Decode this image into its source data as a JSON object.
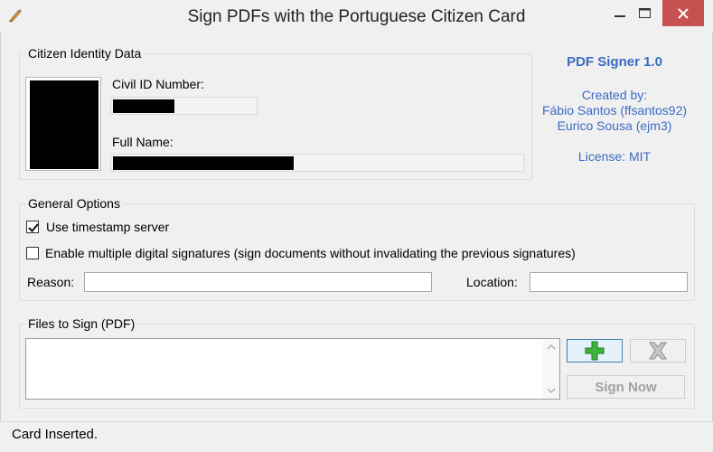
{
  "window": {
    "title": "Sign PDFs with the Portuguese Citizen Card"
  },
  "identity": {
    "group_title": "Citizen Identity Data",
    "civil_id_label": "Civil ID Number:",
    "full_name_label": "Full Name:"
  },
  "about": {
    "app_name": "PDF Signer 1.0",
    "created_by_label": "Created by:",
    "author1": "Fábio Santos (ffsantos92)",
    "author2": "Eurico Sousa (ejm3)",
    "license": "License: MIT"
  },
  "options": {
    "group_title": "General Options",
    "timestamp_label": "Use timestamp server",
    "timestamp_checked": true,
    "multi_sig_label": "Enable multiple digital signatures (sign documents without invalidating the previous signatures)",
    "multi_sig_checked": false,
    "reason_label": "Reason:",
    "reason_value": "",
    "location_label": "Location:",
    "location_value": ""
  },
  "files": {
    "group_title": "Files to Sign (PDF)",
    "add_icon": "plus-icon",
    "remove_icon": "x-icon",
    "sign_label": "Sign Now"
  },
  "status": {
    "text": "Card Inserted."
  },
  "colors": {
    "accent": "#3a6bc4",
    "close_button": "#c75050",
    "add_green": "#2fa82f"
  }
}
